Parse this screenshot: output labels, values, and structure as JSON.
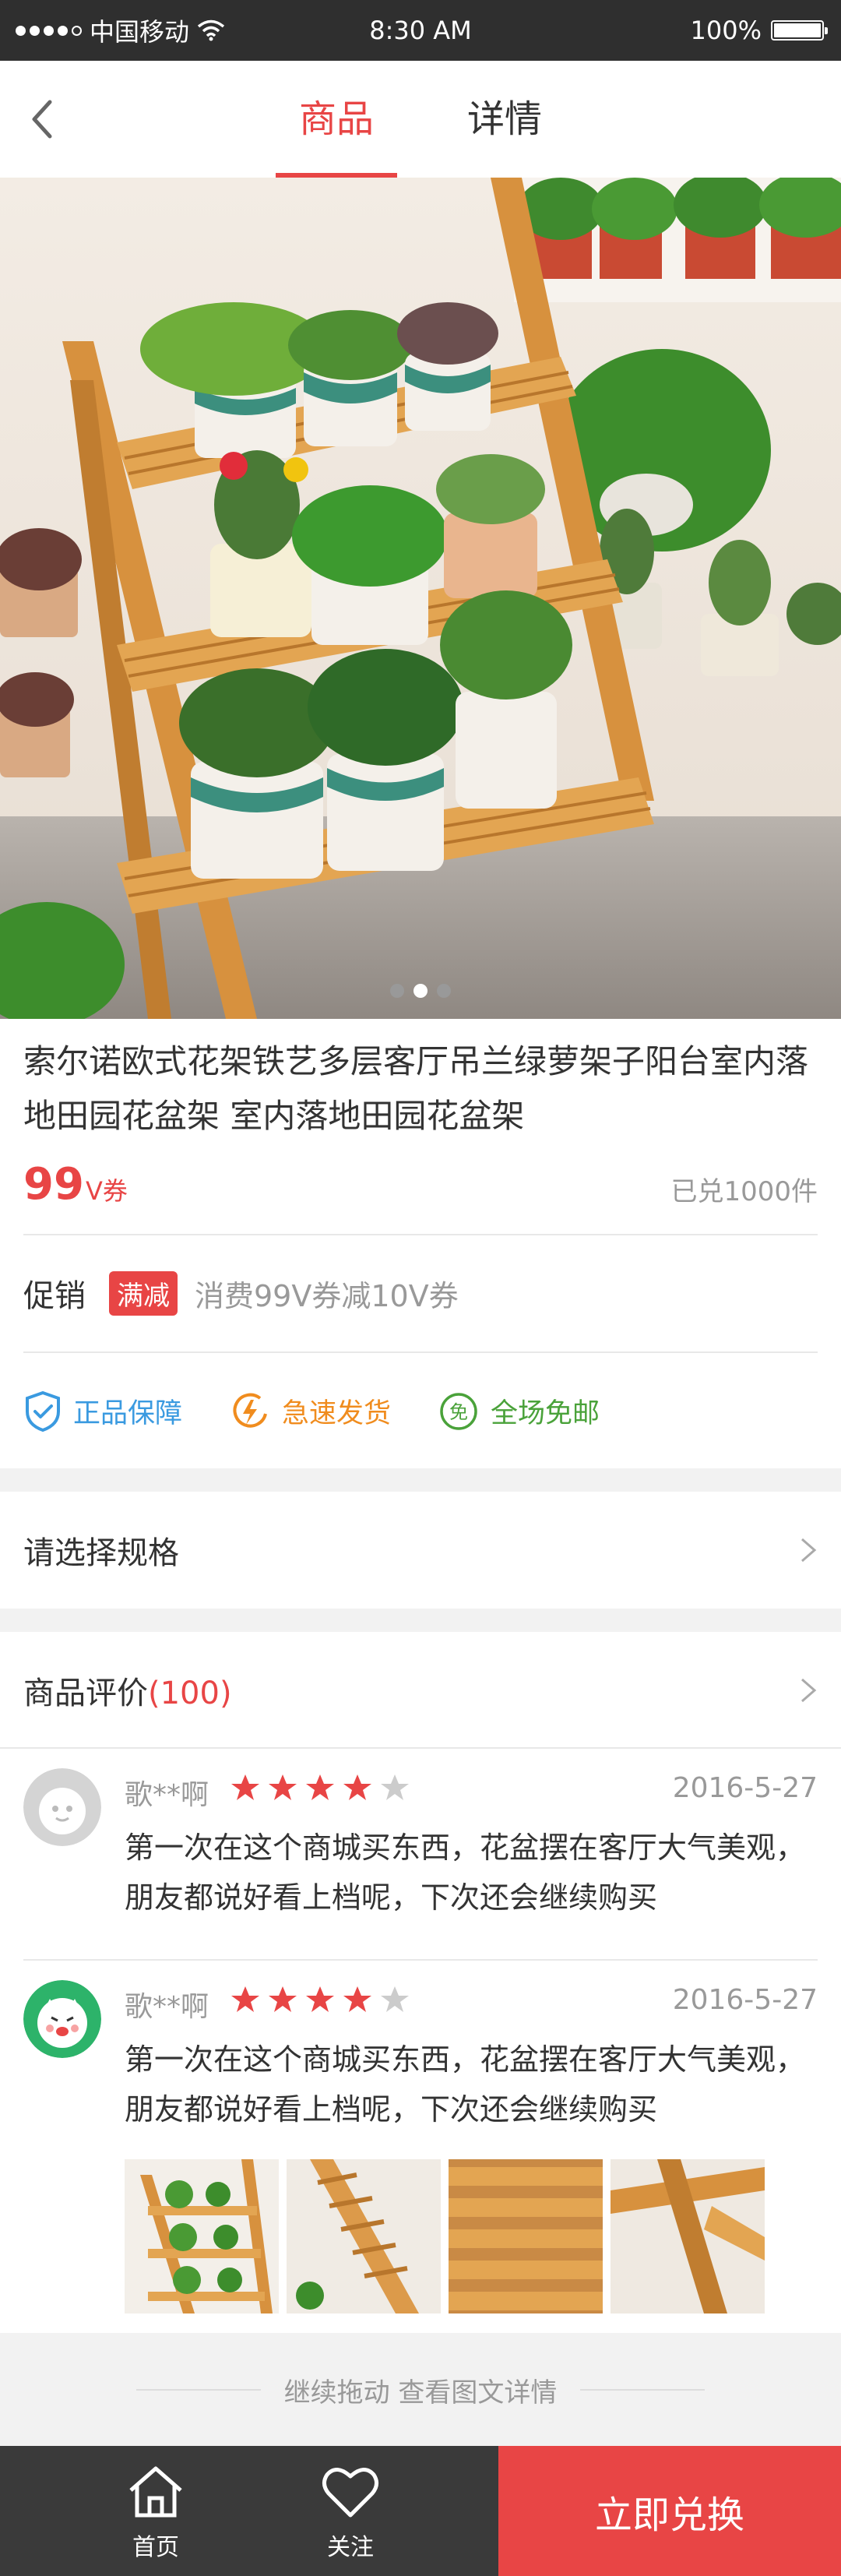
{
  "status_bar": {
    "carrier": "中国移动",
    "time": "8:30 AM",
    "battery": "100%"
  },
  "nav": {
    "tabs": [
      {
        "label": "商品"
      },
      {
        "label": "详情"
      }
    ]
  },
  "product": {
    "title": "索尔诺欧式花架铁艺多层客厅吊兰绿萝架子阳台室内落地田园花盆架 室内落地田园花盆架",
    "price": "99",
    "price_unit": "V券",
    "sold": "已兑1000件"
  },
  "promotion": {
    "label": "促销",
    "badge": "满减",
    "text": "消费99V券减10V券"
  },
  "guarantees": [
    {
      "label": "正品保障",
      "icon": "shield-check-icon"
    },
    {
      "label": "急速发货",
      "icon": "lightning-clock-icon"
    },
    {
      "label": "全场免邮",
      "icon": "free-shipping-icon"
    }
  ],
  "spec": {
    "label": "请选择规格"
  },
  "reviews": {
    "title": "商品评价",
    "count": "(100)",
    "items": [
      {
        "name": "歌**啊",
        "rating": 4,
        "max_rating": 5,
        "date": "2016-5-27",
        "text": "第一次在这个商城买东西，花盆摆在客厅大气美观，朋友都说好看上档呢，下次还会继续购买"
      },
      {
        "name": "歌**啊",
        "rating": 4,
        "max_rating": 5,
        "date": "2016-5-27",
        "text": "第一次在这个商城买东西，花盆摆在客厅大气美观，朋友都说好看上档呢，下次还会继续购买"
      }
    ]
  },
  "more_hint": "继续拖动 查看图文详情",
  "bottom_bar": {
    "home_label": "首页",
    "follow_label": "关注",
    "cta_label": "立即兑换"
  },
  "colors": {
    "accent": "#e84545",
    "dark_bar": "#3a3a3a",
    "blue": "#3a9ae0",
    "orange": "#f08c1e",
    "green": "#4aa23a"
  }
}
